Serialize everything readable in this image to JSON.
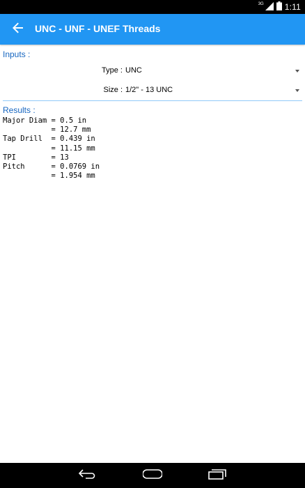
{
  "status_bar": {
    "network": "3G",
    "time": "1:11"
  },
  "app_bar": {
    "title": "UNC - UNF - UNEF Threads"
  },
  "inputs": {
    "label": "Inputs :",
    "type": {
      "label": "Type :",
      "value": "UNC"
    },
    "size": {
      "label": "Size :",
      "value": "1/2\" - 13 UNC"
    }
  },
  "results": {
    "label": "Results :",
    "lines": [
      "Major Diam = 0.5 in",
      "           = 12.7 mm",
      "Tap Drill  = 0.439 in",
      "           = 11.15 mm",
      "TPI        = 13",
      "Pitch      = 0.0769 in",
      "           = 1.954 mm"
    ]
  },
  "colors": {
    "app_bar": "#2196f3",
    "section_label": "#1565c0",
    "divider": "#90caf9",
    "status_bar": "#000000",
    "nav_bar": "#000000"
  },
  "icons": {
    "back": "arrow-left-icon",
    "dropdown": "triangle-down-icon",
    "nav_back": "nav-back-icon",
    "nav_home": "nav-home-icon",
    "nav_recents": "nav-recents-icon",
    "signal": "signal-icon",
    "battery": "battery-icon"
  }
}
